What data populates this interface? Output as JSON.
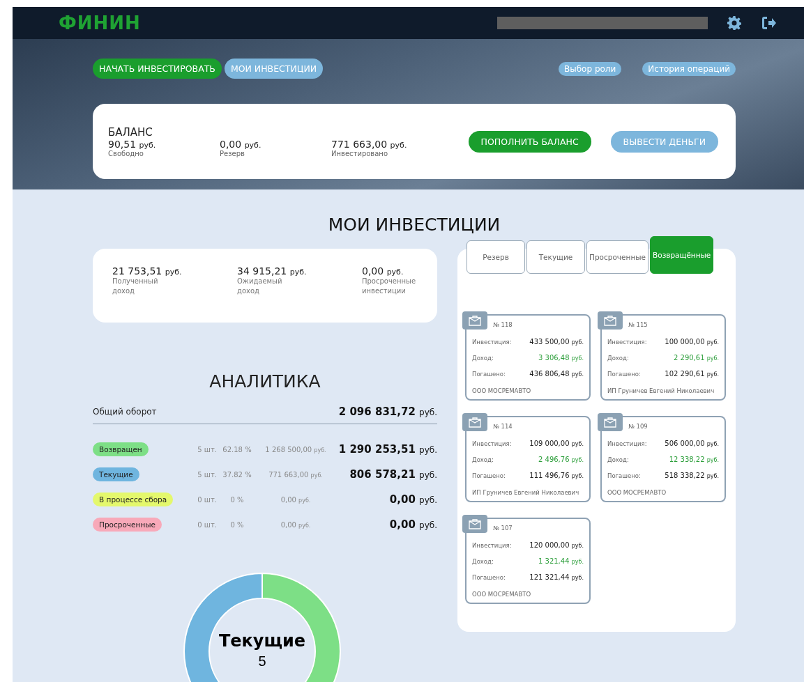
{
  "header": {
    "logo": "ФИНИН"
  },
  "hero": {
    "nav": [
      {
        "label": "НАЧАТЬ ИНВЕСТИРОВАТЬ",
        "kind": "primary"
      },
      {
        "label": "МОИ ИНВЕСТИЦИИ",
        "kind": "secondary"
      }
    ],
    "links": [
      "Выбор роли",
      "История операций"
    ],
    "balance": {
      "title": "БАЛАНС",
      "items": [
        {
          "amount": "90,51",
          "unit": "руб.",
          "caption": "Свободно"
        },
        {
          "amount": "0,00",
          "unit": "руб.",
          "caption": "Резерв"
        },
        {
          "amount": "771 663,00",
          "unit": "руб.",
          "caption": "Инвестировано"
        }
      ],
      "buttons": [
        {
          "label": "ПОПОЛНИТЬ БАЛАНС",
          "kind": "primary"
        },
        {
          "label": "ВЫВЕСТИ ДЕНЬГИ",
          "kind": "secondary"
        }
      ]
    }
  },
  "page_title": "МОИ ИНВЕСТИЦИИ",
  "summary": [
    {
      "amount": "21 753,51",
      "unit": "руб.",
      "caption": "Полученный доход"
    },
    {
      "amount": "34 915,21",
      "unit": "руб.",
      "caption": "Ожидаемый доход"
    },
    {
      "amount": "0,00",
      "unit": "руб.",
      "caption": "Просроченные инвестиции"
    }
  ],
  "analytics": {
    "title": "АНАЛИТИКА",
    "total": {
      "label": "Общий оборот",
      "amount": "2 096 831,72",
      "unit": "руб."
    },
    "rows": [
      {
        "status": "Возвращен",
        "color": "#7ddf86",
        "count": "5 шт.",
        "percent": "62.18 %",
        "sum": "1 268 500,00",
        "sum_unit": "руб.",
        "amount": "1 290 253,51",
        "unit": "руб."
      },
      {
        "status": "Текущие",
        "color": "#6fb5df",
        "count": "5 шт.",
        "percent": "37.82 %",
        "sum": "771 663,00",
        "sum_unit": "руб.",
        "amount": "806 578,21",
        "unit": "руб."
      },
      {
        "status": "В процессе сбора",
        "color": "#e4f86c",
        "count": "0 шт.",
        "percent": "0 %",
        "sum": "0,00",
        "sum_unit": "руб.",
        "amount": "0,00",
        "unit": "руб."
      },
      {
        "status": "Просроченные",
        "color": "#f8a9b9",
        "count": "0 шт.",
        "percent": "0 %",
        "sum": "0,00",
        "sum_unit": "руб.",
        "amount": "0,00",
        "unit": "руб."
      }
    ],
    "center_label": "Текущие",
    "center_value": "5"
  },
  "tabs": [
    {
      "label": "Резерв",
      "selected": false
    },
    {
      "label": "Текущие",
      "selected": false
    },
    {
      "label": "Просроченные",
      "selected": false
    },
    {
      "label": "Возвращённые",
      "selected": true
    }
  ],
  "investments": [
    {
      "number": "№ 118",
      "rows": [
        {
          "label": "Инвестиция:",
          "amount": "433 500,00",
          "unit": "руб.",
          "kind": "plain"
        },
        {
          "label": "Доход:",
          "amount": "3 306,48",
          "unit": "руб.",
          "kind": "income"
        },
        {
          "label": "Погашено:",
          "amount": "436 806,48",
          "unit": "руб.",
          "kind": "plain"
        }
      ],
      "borrower": "ООО МОСРЕМАВТО"
    },
    {
      "number": "№ 115",
      "rows": [
        {
          "label": "Инвестиция:",
          "amount": "100 000,00",
          "unit": "руб.",
          "kind": "plain"
        },
        {
          "label": "Доход:",
          "amount": "2 290,61",
          "unit": "руб.",
          "kind": "income"
        },
        {
          "label": "Погашено:",
          "amount": "102 290,61",
          "unit": "руб.",
          "kind": "plain"
        }
      ],
      "borrower": "ИП Груничев Евгений Николаевич"
    },
    {
      "number": "№ 114",
      "rows": [
        {
          "label": "Инвестиция:",
          "amount": "109 000,00",
          "unit": "руб.",
          "kind": "plain"
        },
        {
          "label": "Доход:",
          "amount": "2 496,76",
          "unit": "руб.",
          "kind": "income"
        },
        {
          "label": "Погашено:",
          "amount": "111 496,76",
          "unit": "руб.",
          "kind": "plain"
        }
      ],
      "borrower": "ИП Груничев Евгений Николаевич"
    },
    {
      "number": "№ 109",
      "rows": [
        {
          "label": "Инвестиция:",
          "amount": "506 000,00",
          "unit": "руб.",
          "kind": "plain"
        },
        {
          "label": "Доход:",
          "amount": "12 338,22",
          "unit": "руб.",
          "kind": "income"
        },
        {
          "label": "Погашено:",
          "amount": "518 338,22",
          "unit": "руб.",
          "kind": "plain"
        }
      ],
      "borrower": "ООО МОСРЕМАВТО"
    },
    {
      "number": "№ 107",
      "rows": [
        {
          "label": "Инвестиция:",
          "amount": "120 000,00",
          "unit": "руб.",
          "kind": "plain"
        },
        {
          "label": "Доход:",
          "amount": "1 321,44",
          "unit": "руб.",
          "kind": "income"
        },
        {
          "label": "Погашено:",
          "amount": "121 321,44",
          "unit": "руб.",
          "kind": "plain"
        }
      ],
      "borrower": "ООО МОСРЕМАВТО"
    }
  ]
}
